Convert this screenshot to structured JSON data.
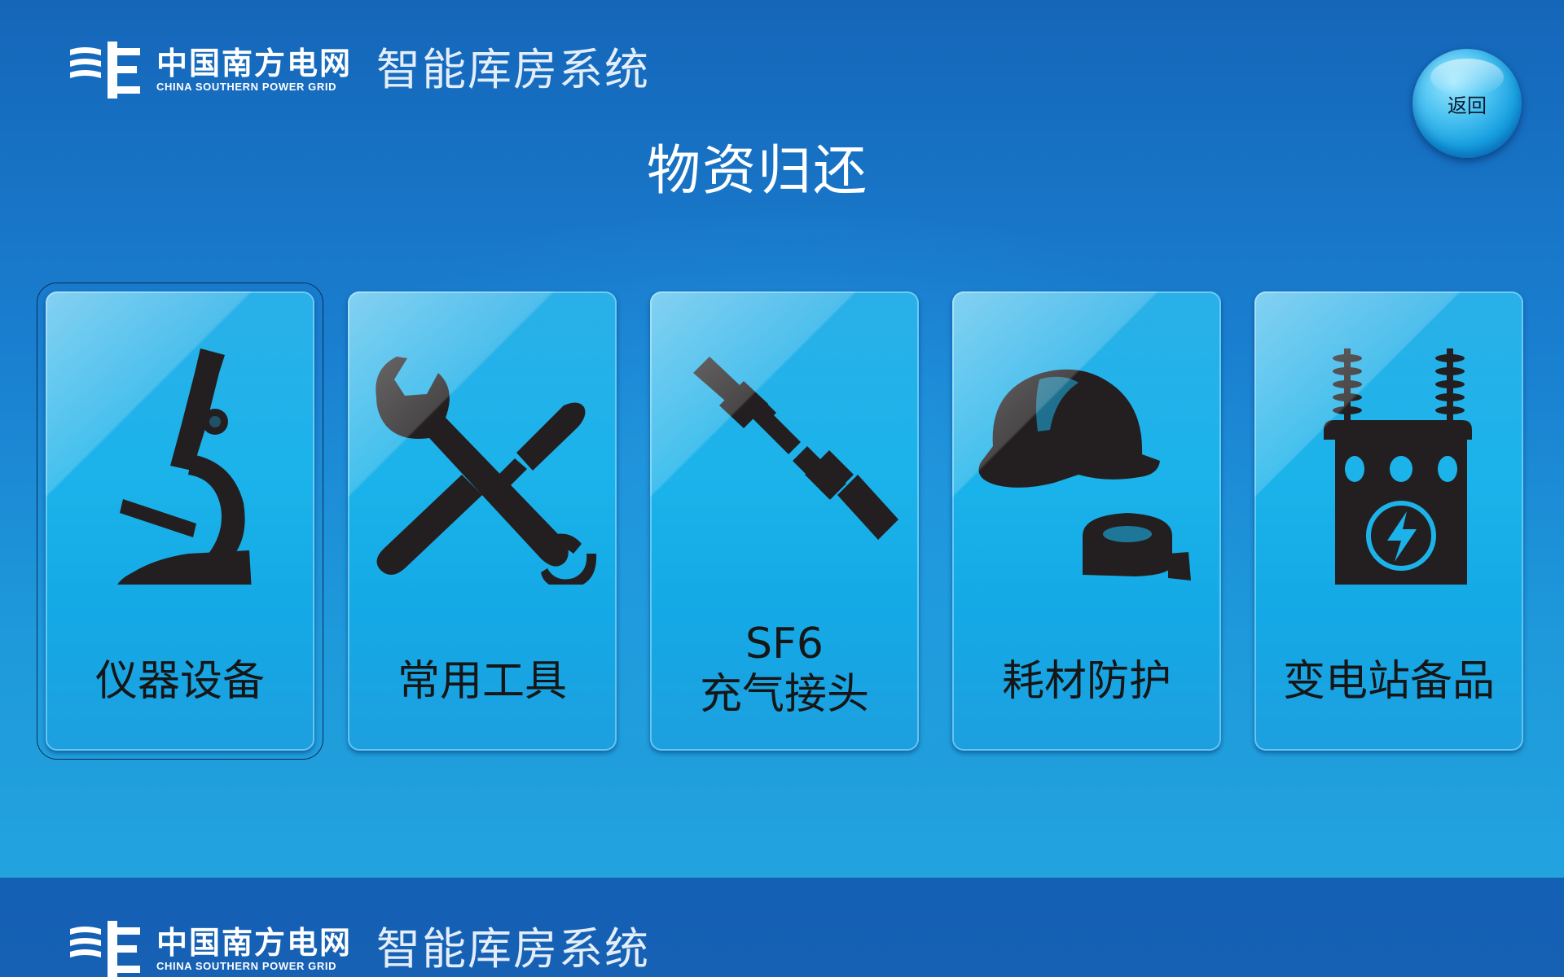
{
  "header": {
    "brand_cn": "中国南方电网",
    "brand_en": "CHINA SOUTHERN POWER GRID",
    "system_name": "智能库房系统"
  },
  "page": {
    "title": "物资归还",
    "back_label": "返回"
  },
  "categories": [
    {
      "label": "仪器设备",
      "icon": "microscope-icon",
      "selected": true
    },
    {
      "label": "常用工具",
      "icon": "wrench-screwdriver-icon"
    },
    {
      "label_line1": "SF6",
      "label_line2": "充气接头",
      "icon": "gas-connector-icon"
    },
    {
      "label": "耗材防护",
      "icon": "helmet-tape-icon"
    },
    {
      "label": "变电站备品",
      "icon": "transformer-icon"
    }
  ],
  "footer": {
    "brand_cn": "中国南方电网",
    "brand_en": "CHINA SOUTHERN POWER GRID",
    "system_name": "智能库房系统"
  },
  "colors": {
    "background_top": "#1566b9",
    "background_bottom": "#22a3de",
    "card": "#1bb3ea",
    "icon": "#231f20",
    "footer_band": "#1460b4"
  }
}
